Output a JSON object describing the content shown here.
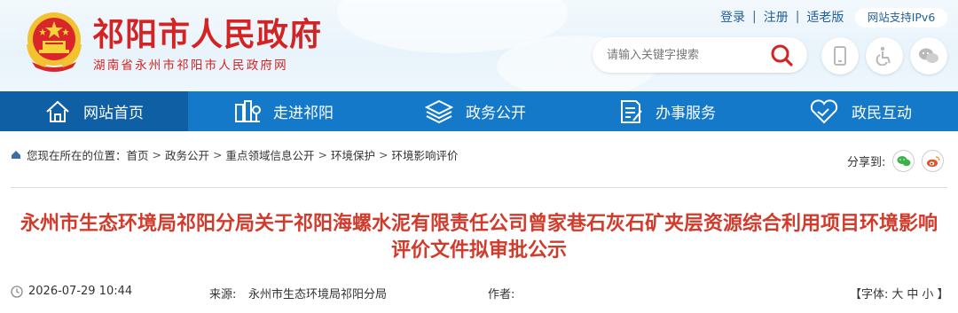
{
  "header": {
    "site_name": "祁阳市人民政府",
    "site_sub": "湖南省永州市祁阳市人民政府网",
    "top_links": [
      "登录",
      "注册",
      "适老版"
    ],
    "ipv6_badge": "网站支持IPv6",
    "search_placeholder": "请输入关键字搜索",
    "icons": [
      "mobile-icon",
      "accessibility-icon",
      "wechat-icon"
    ]
  },
  "nav": {
    "items": [
      {
        "label": "网站首页",
        "icon": "home-icon"
      },
      {
        "label": "走进祁阳",
        "icon": "city-icon"
      },
      {
        "label": "政务公开",
        "icon": "layers-icon"
      },
      {
        "label": "办事服务",
        "icon": "document-icon"
      },
      {
        "label": "政民互动",
        "icon": "handshake-icon"
      }
    ],
    "active_index": 0
  },
  "breadcrumb": {
    "prefix": "您现在所在的位置：",
    "items": [
      "首页",
      "政务公开",
      "重点领域信息公开",
      "环境保护",
      "环境影响评价"
    ]
  },
  "share": {
    "label": "分享到:",
    "targets": [
      "wechat",
      "weibo"
    ]
  },
  "article": {
    "title": "永州市生态环境局祁阳分局关于祁阳海螺水泥有限责任公司曾家巷石灰石矿夹层资源综合利用项目环境影响评价文件拟审批公示",
    "date": "2026-07-29 10:44",
    "source_label": "来源:",
    "source": "永州市生态环境局祁阳分局",
    "author_label": "作者:",
    "font_label": "【字体:",
    "font_sizes": [
      "大",
      "中",
      "小"
    ],
    "font_end": "】"
  },
  "colors": {
    "brand_red": "#d32323",
    "nav_blue": "#1479c8",
    "nav_active": "#0f5fa4",
    "title_red": "#d13b2c"
  }
}
